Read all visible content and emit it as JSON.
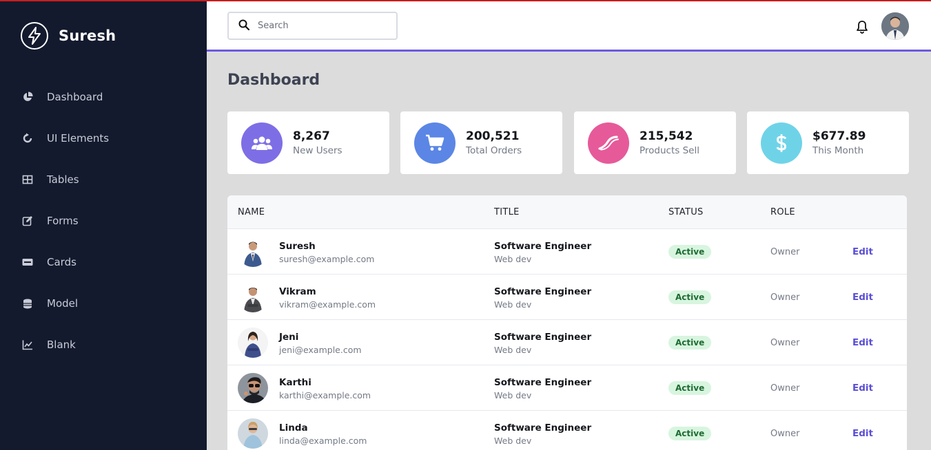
{
  "brand": {
    "name": "Suresh",
    "logo_icon": "lightning-bolt-icon"
  },
  "sidebar": {
    "items": [
      {
        "label": "Dashboard",
        "icon": "pie-chart-icon"
      },
      {
        "label": "UI Elements",
        "icon": "circle-arrow-icon"
      },
      {
        "label": "Tables",
        "icon": "grid-table-icon"
      },
      {
        "label": "Forms",
        "icon": "edit-form-icon"
      },
      {
        "label": "Cards",
        "icon": "credit-card-icon"
      },
      {
        "label": "Model",
        "icon": "database-icon"
      },
      {
        "label": "Blank",
        "icon": "line-chart-icon"
      }
    ]
  },
  "header": {
    "search_placeholder": "Search",
    "accent_color": "#6b5ae0"
  },
  "main": {
    "title": "Dashboard",
    "stats": [
      {
        "value": "8,267",
        "label": "New Users",
        "icon": "users-icon",
        "color": "#7e6ee6"
      },
      {
        "value": "200,521",
        "label": "Total Orders",
        "icon": "cart-icon",
        "color": "#5b86e5"
      },
      {
        "value": "215,542",
        "label": "Products Sell",
        "icon": "products-icon",
        "color": "#e65a9a"
      },
      {
        "value": "$677.89",
        "label": "This Month",
        "icon": "dollar-icon",
        "color": "#6fd3e8"
      }
    ]
  },
  "table": {
    "headers": {
      "name": "NAME",
      "title": "TITLE",
      "status": "STATUS",
      "role": "ROLE"
    },
    "rows": [
      {
        "name": "Suresh",
        "email": "suresh@example.com",
        "title": "Software Engineer",
        "subtitle": "Web dev",
        "status": "Active",
        "role": "Owner",
        "action": "Edit"
      },
      {
        "name": "Vikram",
        "email": "vikram@example.com",
        "title": "Software Engineer",
        "subtitle": "Web dev",
        "status": "Active",
        "role": "Owner",
        "action": "Edit"
      },
      {
        "name": "Jeni",
        "email": "jeni@example.com",
        "title": "Software Engineer",
        "subtitle": "Web dev",
        "status": "Active",
        "role": "Owner",
        "action": "Edit"
      },
      {
        "name": "Karthi",
        "email": "karthi@example.com",
        "title": "Software Engineer",
        "subtitle": "Web dev",
        "status": "Active",
        "role": "Owner",
        "action": "Edit"
      },
      {
        "name": "Linda",
        "email": "linda@example.com",
        "title": "Software Engineer",
        "subtitle": "Web dev",
        "status": "Active",
        "role": "Owner",
        "action": "Edit"
      }
    ]
  }
}
